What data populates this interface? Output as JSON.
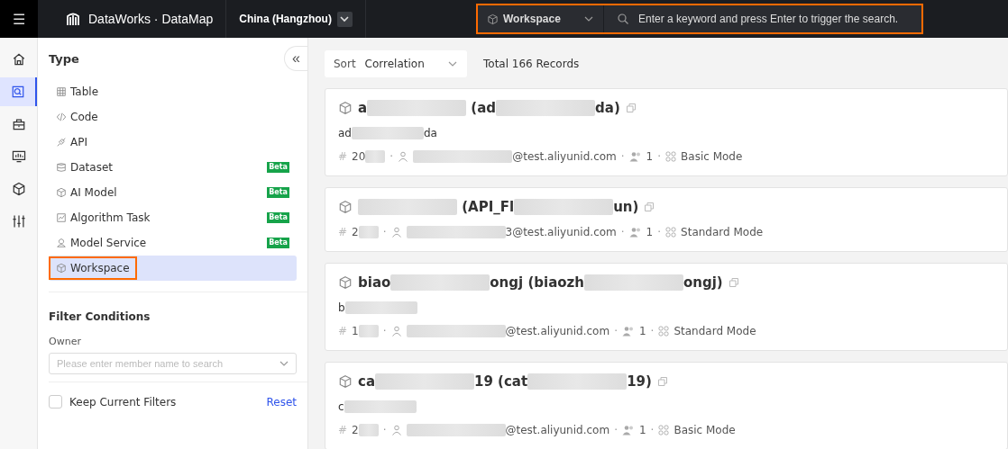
{
  "topbar": {
    "menu_glyph": "☰",
    "product": "DataWorks · DataMap",
    "region": "China (Hangzhou)",
    "search_scope": "Workspace",
    "search_placeholder": "Enter a keyword and press Enter to trigger the search.",
    "highlighted": true
  },
  "rail": [
    {
      "kind": "home",
      "selected": false
    },
    {
      "kind": "search",
      "selected": true
    },
    {
      "kind": "toolbox",
      "selected": false
    },
    {
      "kind": "monitor",
      "selected": false
    },
    {
      "kind": "cube",
      "selected": false
    },
    {
      "kind": "sliders",
      "selected": false
    }
  ],
  "type_panel": {
    "title": "Type",
    "collapse_glyph": "«",
    "items": [
      {
        "kind": "table",
        "label": "Table",
        "selected": false,
        "highlighted": false
      },
      {
        "kind": "code",
        "label": "Code",
        "selected": false,
        "highlighted": false
      },
      {
        "kind": "api",
        "label": "API",
        "selected": false,
        "highlighted": false
      },
      {
        "kind": "dataset",
        "label": "Dataset",
        "badge": "Beta",
        "selected": false,
        "highlighted": false
      },
      {
        "kind": "model",
        "label": "AI Model",
        "badge": "Beta",
        "selected": false,
        "highlighted": false
      },
      {
        "kind": "task",
        "label": "Algorithm Task",
        "badge": "Beta",
        "selected": false,
        "highlighted": false
      },
      {
        "kind": "service",
        "label": "Model Service",
        "badge": "Beta",
        "selected": false,
        "highlighted": false
      },
      {
        "kind": "workspace",
        "label": "Workspace",
        "selected": true,
        "highlighted": true
      }
    ]
  },
  "filters": {
    "title": "Filter Conditions",
    "owner_label": "Owner",
    "owner_placeholder": "Please enter member name to search",
    "keep_label": "Keep Current Filters",
    "keep_checked": false,
    "reset": "Reset"
  },
  "results": {
    "sort_label": "Sort",
    "sort_value": "Correlation",
    "total": "Total 166 Records",
    "cards": [
      {
        "title": [
          {
            "kind": "text",
            "text": "a"
          },
          {
            "kind": "redacted"
          },
          {
            "kind": "text",
            "text": " (ad"
          },
          {
            "kind": "redacted"
          },
          {
            "kind": "text",
            "text": "da)"
          }
        ],
        "description": [
          {
            "kind": "text",
            "text": "ad"
          },
          {
            "kind": "redacted"
          },
          {
            "kind": "text",
            "text": "da"
          }
        ],
        "id_mark": "#",
        "id": [
          {
            "kind": "text",
            "text": "20"
          },
          {
            "kind": "redacted"
          }
        ],
        "separators": [
          "·",
          "·",
          "·"
        ],
        "owner": [
          {
            "kind": "redacted"
          },
          {
            "kind": "text",
            "text": "@test.aliyunid.com"
          }
        ],
        "members": "1",
        "mode": "Basic Mode"
      },
      {
        "title": [
          {
            "kind": "redacted"
          },
          {
            "kind": "text",
            "text": " (API_Fl"
          },
          {
            "kind": "redacted"
          },
          {
            "kind": "text",
            "text": "un)"
          }
        ],
        "id_mark": "#",
        "id": [
          {
            "kind": "text",
            "text": "2"
          },
          {
            "kind": "redacted"
          }
        ],
        "separators": [
          "·",
          "·",
          "·"
        ],
        "owner": [
          {
            "kind": "redacted"
          },
          {
            "kind": "text",
            "text": "3@test.aliyunid.com"
          }
        ],
        "members": "1",
        "mode": "Standard Mode"
      },
      {
        "title": [
          {
            "kind": "text",
            "text": "biao"
          },
          {
            "kind": "redacted"
          },
          {
            "kind": "text",
            "text": "ongj (biaozh"
          },
          {
            "kind": "redacted"
          },
          {
            "kind": "text",
            "text": "ongj)"
          }
        ],
        "description": [
          {
            "kind": "text",
            "text": "b"
          },
          {
            "kind": "redacted"
          }
        ],
        "id_mark": "#",
        "id": [
          {
            "kind": "text",
            "text": "1"
          },
          {
            "kind": "redacted"
          }
        ],
        "separators": [
          "·",
          "·",
          "·"
        ],
        "owner": [
          {
            "kind": "redacted"
          },
          {
            "kind": "text",
            "text": "@test.aliyunid.com"
          }
        ],
        "members": "1",
        "mode": "Standard Mode"
      },
      {
        "title": [
          {
            "kind": "text",
            "text": "ca"
          },
          {
            "kind": "redacted"
          },
          {
            "kind": "text",
            "text": "19 (cat"
          },
          {
            "kind": "redacted"
          },
          {
            "kind": "text",
            "text": "19)"
          }
        ],
        "description": [
          {
            "kind": "text",
            "text": "c"
          },
          {
            "kind": "redacted"
          }
        ],
        "id_mark": "#",
        "id": [
          {
            "kind": "text",
            "text": "2"
          },
          {
            "kind": "redacted"
          }
        ],
        "separators": [
          "·",
          "·",
          "·"
        ],
        "owner": [
          {
            "kind": "redacted"
          },
          {
            "kind": "text",
            "text": "@test.aliyunid.com"
          }
        ],
        "members": "1",
        "mode": "Basic Mode"
      }
    ]
  }
}
